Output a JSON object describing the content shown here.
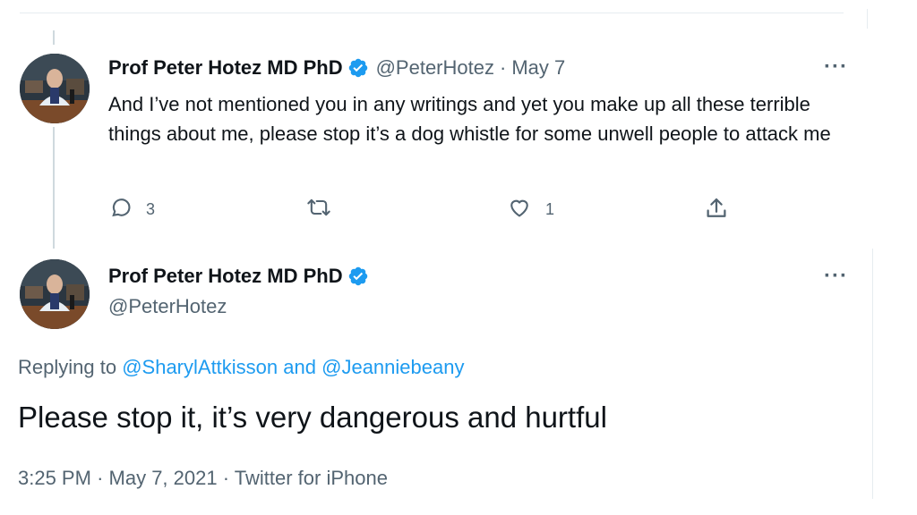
{
  "reply_tweet": {
    "author_name": "Prof Peter Hotez MD PhD",
    "handle": "@PeterHotez",
    "separator": "·",
    "date": "May 7",
    "text": "And I’ve not mentioned you in any writings and yet you make up all these terrible things about me, please stop it’s a dog whistle for some unwell people to attack me",
    "more_label": "···",
    "reply_count": "3",
    "like_count": "1"
  },
  "main_tweet": {
    "author_name": "Prof Peter Hotez MD PhD",
    "handle": "@PeterHotez",
    "more_label": "···",
    "replying_prefix": "Replying to",
    "replying_user_1": "@SharylAttkisson",
    "replying_and": "and",
    "replying_user_2": "@Jeanniebeany",
    "text": "Please stop it, it’s very dangerous and hurtful",
    "time": "3:25 PM",
    "sep1": "·",
    "full_date": "May 7, 2021",
    "sep2": "·",
    "source": "Twitter for iPhone"
  },
  "icons": {
    "verified": "verified-badge-icon",
    "reply": "reply-icon",
    "retweet": "retweet-icon",
    "like": "like-icon",
    "share": "share-icon",
    "more": "more-icon"
  },
  "colors": {
    "accent": "#1d9bf0",
    "text": "#0f1419",
    "muted": "#536471",
    "thread_line": "#cfd9de"
  }
}
